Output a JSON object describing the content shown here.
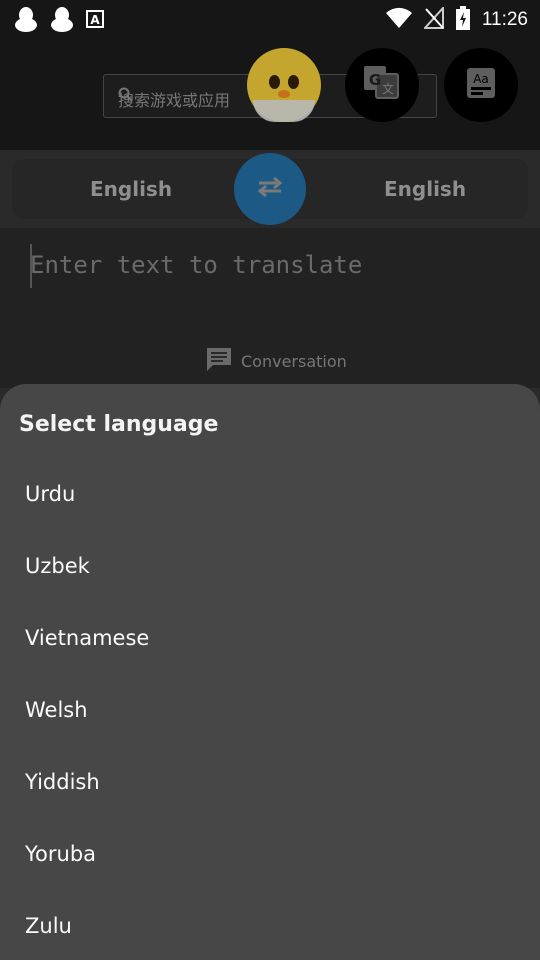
{
  "status_bar": {
    "time": "11:26",
    "left_icons": [
      "qq-icon",
      "qq-icon",
      "a-box-icon"
    ],
    "right_icons": [
      "wifi-icon",
      "no-signal-icon",
      "battery-charging-icon"
    ]
  },
  "search": {
    "placeholder": "搜索游戏或应用"
  },
  "language_bar": {
    "source": "English",
    "target": "English"
  },
  "input": {
    "placeholder": "Enter text to translate"
  },
  "conversation": {
    "label": "Conversation"
  },
  "language_sheet": {
    "title": "Select language",
    "items": [
      "Urdu",
      "Uzbek",
      "Vietnamese",
      "Welsh",
      "Yiddish",
      "Yoruba",
      "Zulu"
    ]
  },
  "colors": {
    "sheet_bg": "#474747",
    "swap_button": "#1c5a85",
    "screen_bg": "#2a2a2a"
  }
}
